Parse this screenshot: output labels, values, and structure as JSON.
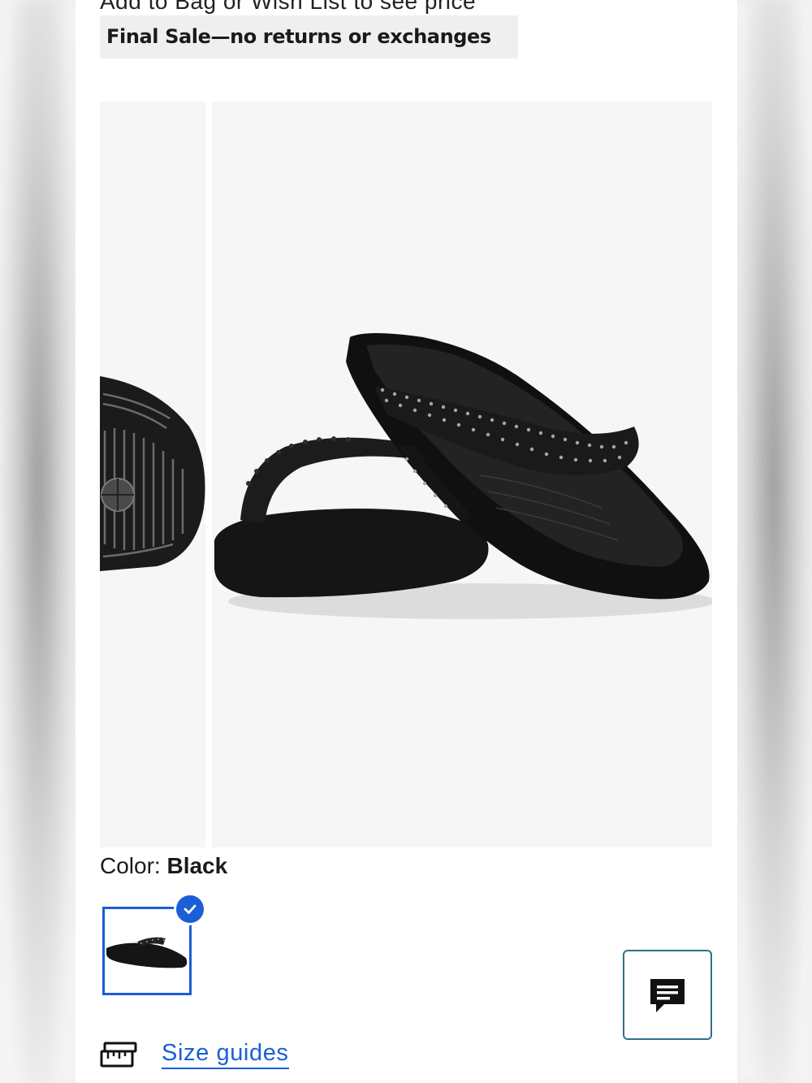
{
  "product": {
    "price_note": "Add to Bag or Wish List to see price",
    "final_sale": "Final Sale—no returns or exchanges",
    "color_label": "Color:",
    "color_value": "Black"
  },
  "gallery": {
    "thumbnail_icon": "sandal-sole-image",
    "main_icon": "sandal-pair-image"
  },
  "swatches": [
    {
      "name": "Black",
      "selected": true
    }
  ],
  "actions": {
    "size_guides": "Size guides",
    "chat_icon": "chat-icon",
    "ruler_icon": "ruler-icon"
  },
  "colors": {
    "accent": "#1a5ed8",
    "chat_border": "#2f6f8a",
    "image_bg": "#f6f6f6"
  }
}
